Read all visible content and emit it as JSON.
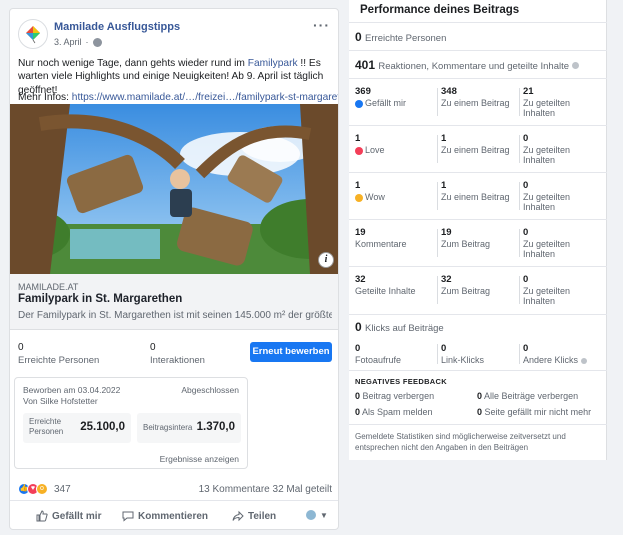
{
  "post": {
    "page_name": "Mamilade Ausflugstipps",
    "date": "3. April",
    "text_1": "Nur noch wenige Tage, dann gehts wieder rund im ",
    "text_hl": "Familypark",
    "text_2": " !! Es warten viele Highlights und einige Neuigkeiten! Ab 9. April ist täglich geöffnet!",
    "more_info_label": "Mehr Infos: ",
    "more_info_url": "https://www.mamilade.at/…/freizei…/familypark-st-margarethen",
    "link_domain": "MAMILADE.AT",
    "link_title": "Familypark in St. Margarethen",
    "link_desc": "Der Familypark in St. Margarethen ist mit seinen 145.000 m² der größte…",
    "reached_num": "0",
    "reached_label": "Erreichte Personen",
    "interactions_num": "0",
    "interactions_label": "Interaktionen",
    "boost_label": "Erneut bewerben",
    "reaction_count": "347",
    "comments": "13 Kommentare",
    "shares": "32 Mal geteilt",
    "like_label": "Gefällt mir",
    "comment_label": "Kommentieren",
    "share_label": "Teilen"
  },
  "promo": {
    "advertised": "Beworben am 03.04.2022",
    "by": "Von Silke Hofstetter",
    "status": "Abgeschlossen",
    "metric1_label": "Erreichte Personen",
    "metric1_value": "25.100,0",
    "metric2_label": "Beitragsintera",
    "metric2_value": "1.370,0",
    "results_link": "Ergebnisse anzeigen"
  },
  "perf": {
    "title": "Performance deines Beitrags",
    "reached_num": "0",
    "reached_label": "Erreichte Personen",
    "reactions_num": "401",
    "reactions_label": "Reaktionen, Kommentare und geteilte Inhalte",
    "rows": [
      {
        "a_num": "369",
        "a_lbl": "Gefällt mir",
        "b_num": "348",
        "b_lbl": "Zu einem Beitrag",
        "c_num": "21",
        "c_lbl": "Zu geteilten Inhalten"
      },
      {
        "a_num": "1",
        "a_lbl": "Love",
        "b_num": "1",
        "b_lbl": "Zu einem Beitrag",
        "c_num": "0",
        "c_lbl": "Zu geteilten Inhalten"
      },
      {
        "a_num": "1",
        "a_lbl": "Wow",
        "b_num": "1",
        "b_lbl": "Zu einem Beitrag",
        "c_num": "0",
        "c_lbl": "Zu geteilten Inhalten"
      },
      {
        "a_num": "19",
        "a_lbl": "Kommentare",
        "b_num": "19",
        "b_lbl": "Zum Beitrag",
        "c_num": "0",
        "c_lbl": "Zu geteilten Inhalten"
      },
      {
        "a_num": "32",
        "a_lbl": "Geteilte Inhalte",
        "b_num": "32",
        "b_lbl": "Zum Beitrag",
        "c_num": "0",
        "c_lbl": "Zu geteilten Inhalten"
      }
    ],
    "clicks_num": "0",
    "clicks_label": "Klicks auf Beiträge",
    "clicks": [
      {
        "num": "0",
        "lbl": "Fotoaufrufe"
      },
      {
        "num": "0",
        "lbl": "Link-Klicks"
      },
      {
        "num": "0",
        "lbl": "Andere Klicks"
      }
    ],
    "neg_title": "NEGATIVES FEEDBACK",
    "neg": [
      {
        "num": "0",
        "lbl": "Beitrag verbergen"
      },
      {
        "num": "0",
        "lbl": "Alle Beiträge verbergen"
      },
      {
        "num": "0",
        "lbl": "Als Spam melden"
      },
      {
        "num": "0",
        "lbl": "Seite gefällt mir nicht mehr"
      }
    ],
    "footnote": "Gemeldete Statistiken sind möglicherweise zeitversetzt und entsprechen nicht den Angaben in den Beiträgen"
  },
  "colors": {
    "brand": "#1877f2",
    "link": "#385898",
    "love": "#f33e58",
    "wow": "#f7b125"
  }
}
